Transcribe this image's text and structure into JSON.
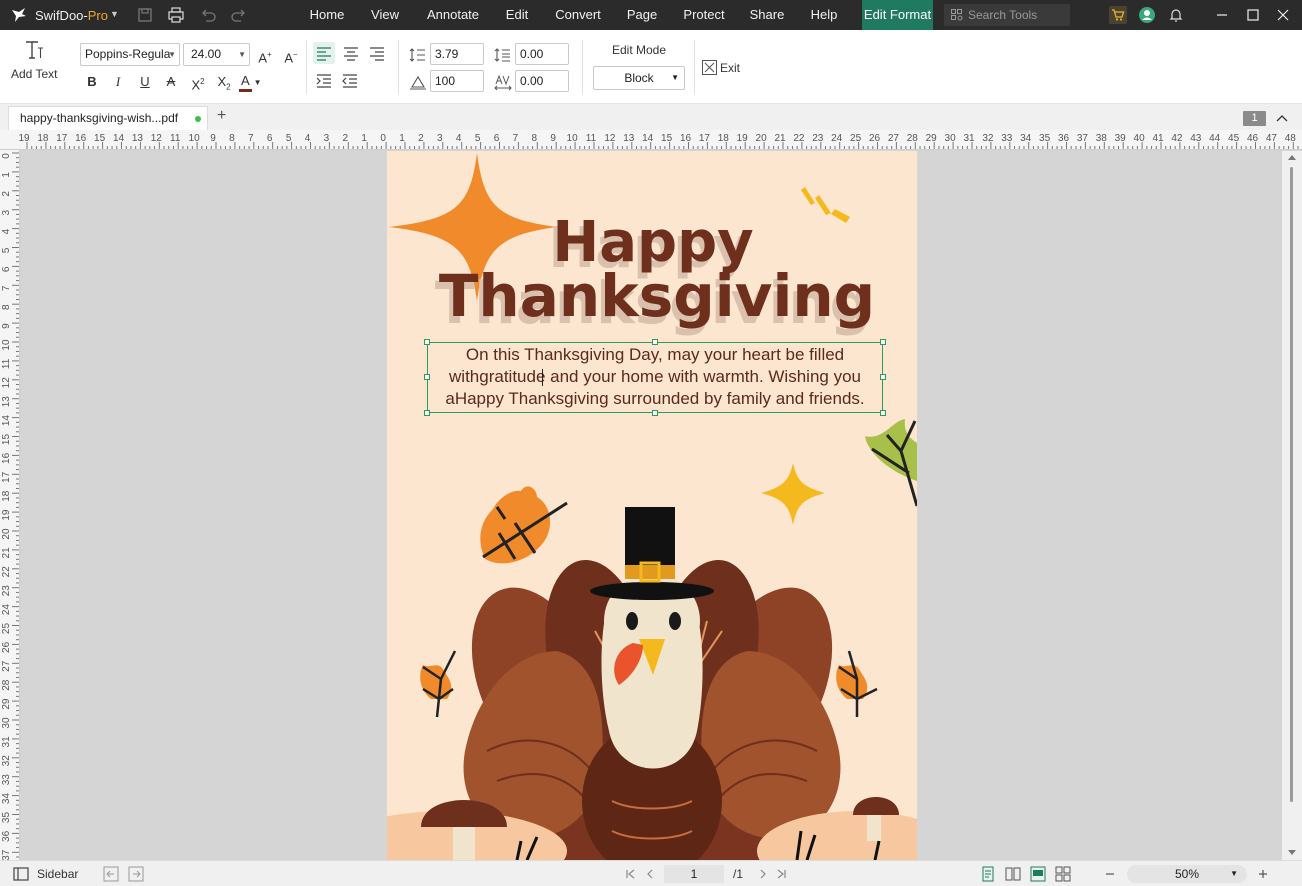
{
  "app": {
    "name_prefix": "SwifDoo-",
    "name_suffix": "Pro"
  },
  "menu": [
    {
      "label": "Home"
    },
    {
      "label": "View"
    },
    {
      "label": "Annotate"
    },
    {
      "label": "Edit"
    },
    {
      "label": "Convert"
    },
    {
      "label": "Page"
    },
    {
      "label": "Protect"
    },
    {
      "label": "Share"
    },
    {
      "label": "Help"
    },
    {
      "label": "Edit Format"
    }
  ],
  "search": {
    "placeholder": "Search Tools"
  },
  "toolbar": {
    "add_text_label": "Add Text",
    "font_family": "Poppins-Regula",
    "font_size": "24.00",
    "line_spacing": "3.79",
    "paragraph_spacing": "0.00",
    "scale": "100",
    "char_spacing": "0.00",
    "edit_mode_label": "Edit Mode",
    "edit_mode_value": "Block",
    "exit_label": "Exit",
    "bold": "B",
    "italic": "I",
    "underline": "U",
    "font_color_letter": "A",
    "font_color": "#7a2a1a"
  },
  "tab": {
    "filename": "happy-thanksgiving-wish...pdf",
    "page_badge": "1"
  },
  "ruler": {
    "horizontal": [
      "19",
      "18",
      "17",
      "16",
      "15",
      "14",
      "13",
      "12",
      "11",
      "10",
      "9",
      "8",
      "7",
      "6",
      "5",
      "4",
      "3",
      "2",
      "1",
      "0",
      "1",
      "2",
      "3",
      "4",
      "5",
      "6",
      "7",
      "8",
      "9",
      "10",
      "11",
      "12",
      "13",
      "14",
      "15",
      "16",
      "17",
      "18",
      "19",
      "20",
      "21",
      "22",
      "23",
      "24",
      "25",
      "26",
      "27",
      "28",
      "29",
      "30",
      "31",
      "32",
      "33",
      "34",
      "35",
      "36",
      "37",
      "38",
      "39",
      "40",
      "41",
      "42",
      "43",
      "44",
      "45",
      "46",
      "47",
      "48"
    ],
    "vertical": [
      "0",
      "1",
      "2",
      "3",
      "4",
      "5",
      "6",
      "7",
      "8",
      "9",
      "10",
      "11",
      "12",
      "13",
      "14",
      "15",
      "16",
      "17",
      "18",
      "19",
      "20",
      "21",
      "22",
      "23",
      "24",
      "25",
      "26",
      "27",
      "28",
      "29",
      "30",
      "31",
      "32",
      "33",
      "34",
      "35",
      "36",
      "37"
    ]
  },
  "document": {
    "title_line1": "Happy",
    "title_line2": "Thanksgiving",
    "body_line1": "On this Thanksgiving Day, may your heart be filled",
    "body_line2": "withgratitude and your home with warmth. Wishing you",
    "body_line3": "aHappy Thanksgiving surrounded by family and friends."
  },
  "status": {
    "sidebar_label": "Sidebar",
    "current_page": "1",
    "total_pages": "/1",
    "zoom": "50%"
  },
  "colors": {
    "accent": "#1f7a5f",
    "title": "#6e2f1d",
    "selection": "#2e9a5c",
    "page_bg": "#fde6d0"
  }
}
